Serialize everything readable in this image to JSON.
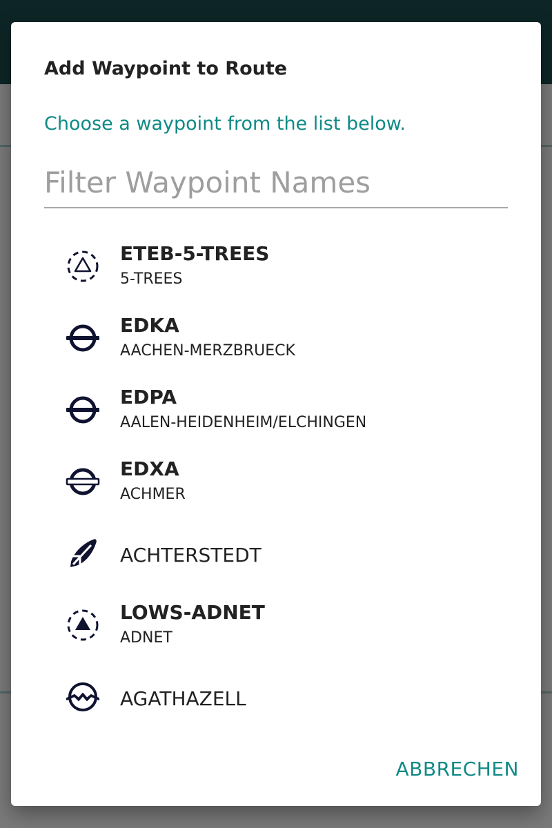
{
  "dialog": {
    "title": "Add Waypoint to Route",
    "subtitle": "Choose a waypoint from the list below.",
    "filter_placeholder": "Filter Waypoint Names",
    "filter_value": "",
    "cancel_label": "ABBRECHEN"
  },
  "waypoints": [
    {
      "name": "ETEB-5-TREES",
      "subtitle": "5-TREES",
      "icon": "heliport-icon"
    },
    {
      "name": "EDKA",
      "subtitle": "AACHEN-MERZBRUECK",
      "icon": "airfield-icon"
    },
    {
      "name": "EDPA",
      "subtitle": "AALEN-HEIDENHEIM/ELCHINGEN",
      "icon": "airfield-icon"
    },
    {
      "name": "EDXA",
      "subtitle": "ACHMER",
      "icon": "airfield-grass-icon"
    },
    {
      "name": "ACHTERSTEDT",
      "subtitle": "",
      "icon": "glider-site-icon"
    },
    {
      "name": "LOWS-ADNET",
      "subtitle": "ADNET",
      "icon": "heliport-filled-icon"
    },
    {
      "name": "AGATHAZELL",
      "subtitle": "",
      "icon": "mountain-airfield-icon"
    }
  ],
  "colors": {
    "accent": "#0f8a85",
    "toolbar": "#1c4f51",
    "icon": "#0f1330",
    "text": "#222222"
  }
}
